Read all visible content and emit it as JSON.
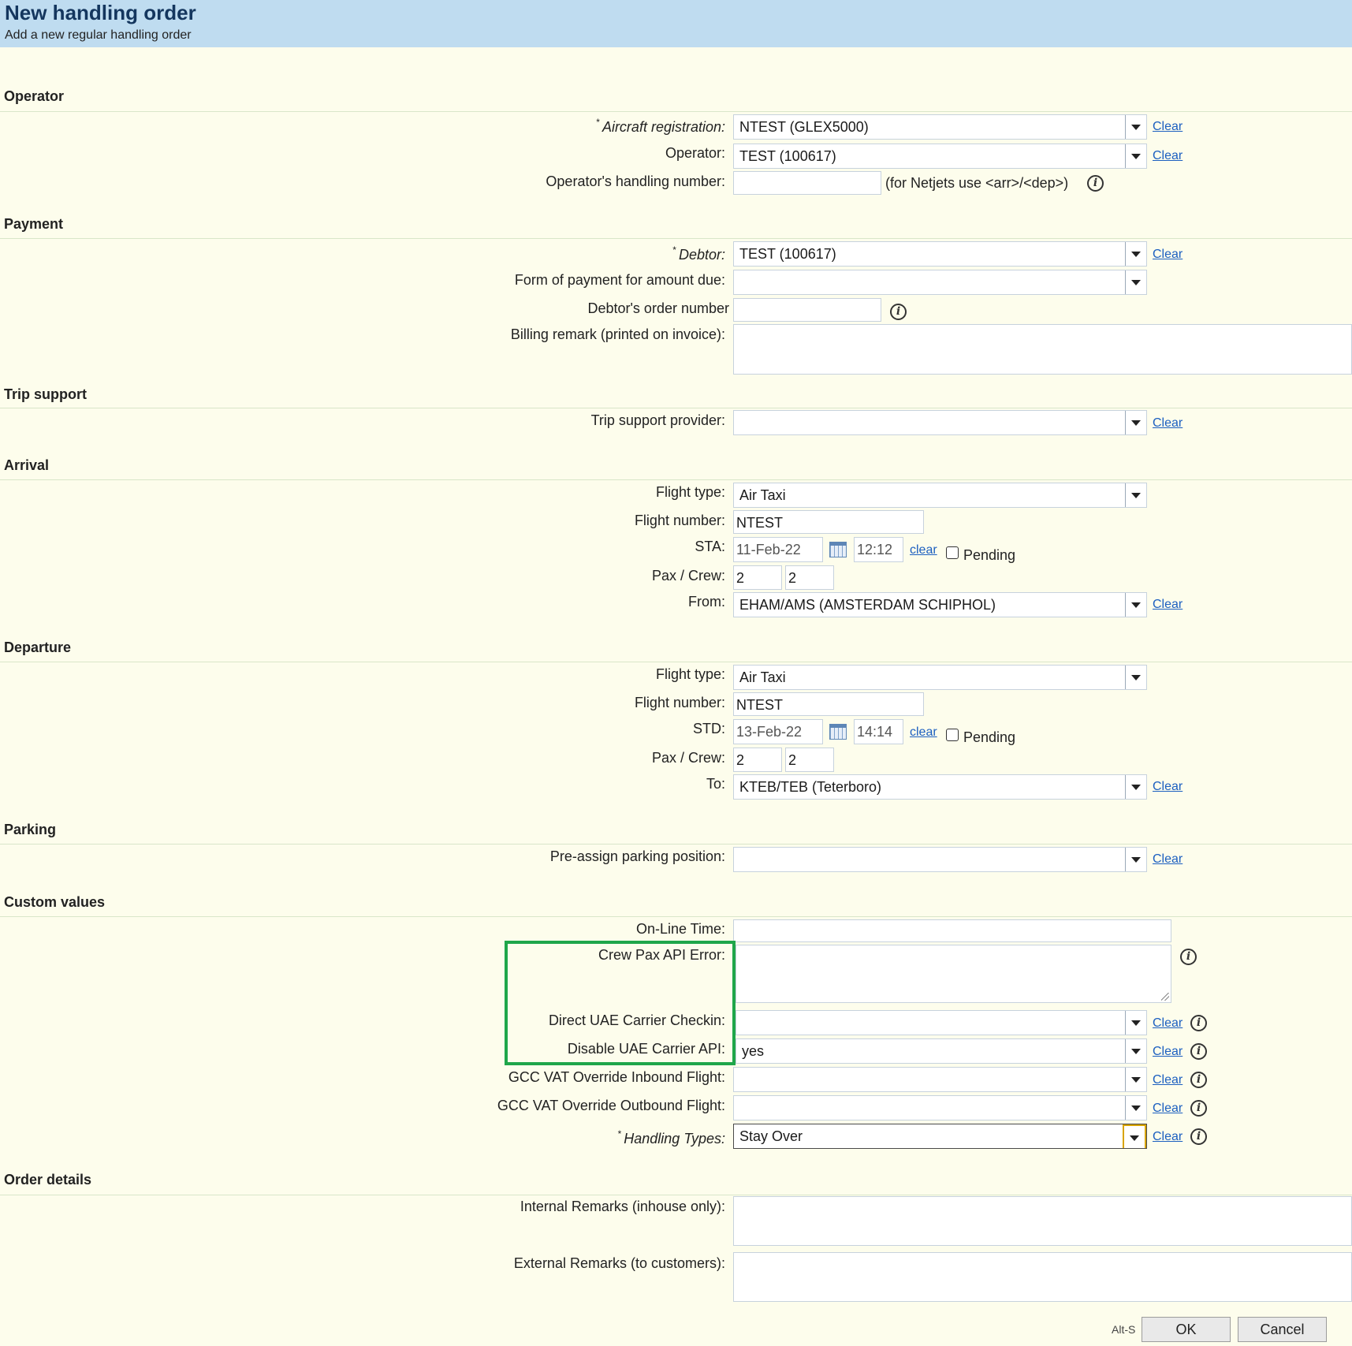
{
  "header": {
    "title": "New handling order",
    "subtitle": "Add a new regular handling order"
  },
  "sections": {
    "operator": "Operator",
    "payment": "Payment",
    "trip_support": "Trip support",
    "arrival": "Arrival",
    "departure": "Departure",
    "parking": "Parking",
    "custom_values": "Custom values",
    "order_details": "Order details"
  },
  "operator": {
    "aircraft_label": "Aircraft registration:",
    "aircraft_value": "NTEST (GLEX5000)",
    "operator_label": "Operator:",
    "operator_value": "TEST (100617)",
    "handling_number_label": "Operator's handling number:",
    "handling_number_value": "",
    "handling_number_hint": "(for Netjets use <arr>/<dep>)"
  },
  "payment": {
    "debtor_label": "Debtor:",
    "debtor_value": "TEST (100617)",
    "form_label": "Form of payment for amount due:",
    "form_value": "",
    "order_number_label": "Debtor's order number",
    "order_number_value": "",
    "billing_label": "Billing remark (printed on invoice):",
    "billing_value": ""
  },
  "trip_support": {
    "provider_label": "Trip support provider:",
    "provider_value": ""
  },
  "arrival": {
    "flight_type_label": "Flight type:",
    "flight_type_value": "Air Taxi",
    "flight_number_label": "Flight number:",
    "flight_number_value": "NTEST",
    "sta_label": "STA:",
    "sta_date": "11-Feb-22",
    "sta_time": "12:12",
    "pax_crew_label": "Pax / Crew:",
    "pax": "2",
    "crew": "2",
    "from_label": "From:",
    "from_value": "EHAM/AMS (AMSTERDAM SCHIPHOL)"
  },
  "departure": {
    "flight_type_label": "Flight type:",
    "flight_type_value": "Air Taxi",
    "flight_number_label": "Flight number:",
    "flight_number_value": "NTEST",
    "std_label": "STD:",
    "std_date": "13-Feb-22",
    "std_time": "14:14",
    "pax_crew_label": "Pax / Crew:",
    "pax": "2",
    "crew": "2",
    "to_label": "To:",
    "to_value": "KTEB/TEB (Teterboro)"
  },
  "parking": {
    "position_label": "Pre-assign parking position:",
    "position_value": ""
  },
  "custom_values": {
    "online_time_label": "On-Line Time:",
    "online_time_value": "",
    "crew_pax_error_label": "Crew Pax API Error:",
    "crew_pax_error_value": "",
    "direct_uae_label": "Direct UAE Carrier Checkin:",
    "direct_uae_value": "",
    "disable_uae_label": "Disable UAE Carrier API:",
    "disable_uae_value": "yes",
    "gcc_inbound_label": "GCC VAT Override Inbound Flight:",
    "gcc_inbound_value": "",
    "gcc_outbound_label": "GCC VAT Override Outbound Flight:",
    "gcc_outbound_value": "",
    "handling_types_label": "Handling Types:",
    "handling_types_value": "Stay Over"
  },
  "order_details": {
    "internal_label": "Internal Remarks (inhouse only):",
    "internal_value": "",
    "external_label": "External Remarks (to customers):",
    "external_value": ""
  },
  "common": {
    "clear_label": "Clear",
    "clear_lower": "clear",
    "pending_label": "Pending",
    "required_star": "*",
    "info_glyph": "i"
  },
  "footer": {
    "shortcut": "Alt-S",
    "ok_label": "OK",
    "cancel_label": "Cancel"
  },
  "colors": {
    "header_bg": "#bfdcf0",
    "page_bg": "#fdfdec",
    "title": "#14365e",
    "link": "#1c5fc0",
    "highlight": "#1fa64a"
  }
}
